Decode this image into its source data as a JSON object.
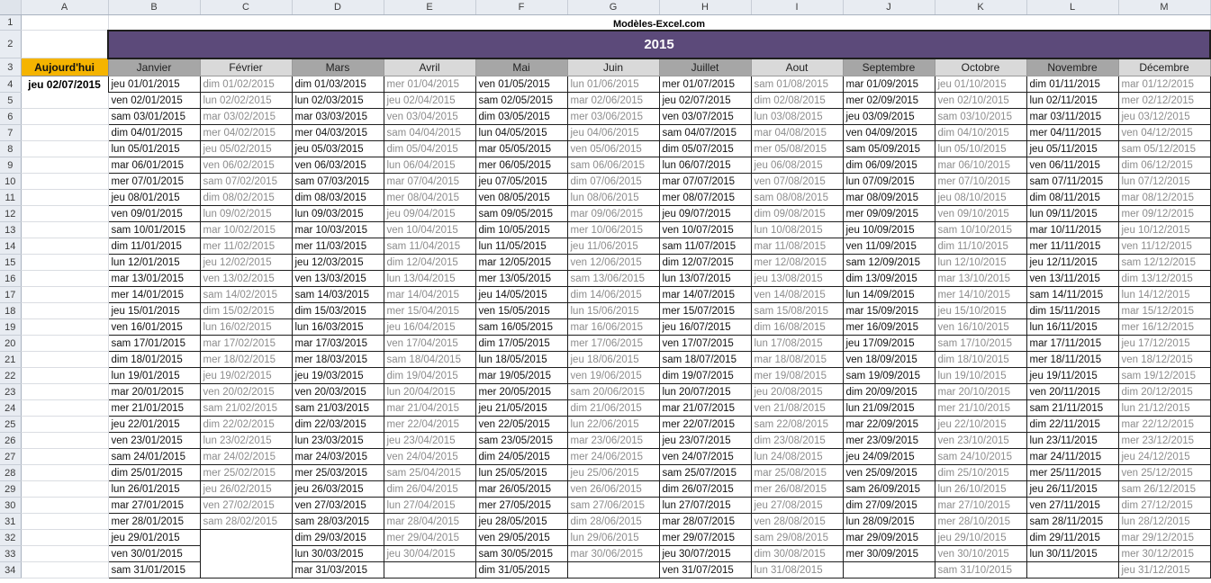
{
  "columns": [
    "A",
    "B",
    "C",
    "D",
    "E",
    "F",
    "G",
    "H",
    "I",
    "J",
    "K",
    "L",
    "M"
  ],
  "site_label": "Modèles-Excel.com",
  "year_label": "2015",
  "today": {
    "label": "Aujourd'hui",
    "value": "jeu 02/07/2015"
  },
  "months": [
    {
      "name": "Janvier",
      "first_wd": 4,
      "days": 31
    },
    {
      "name": "Février",
      "first_wd": 0,
      "days": 28
    },
    {
      "name": "Mars",
      "first_wd": 0,
      "days": 31
    },
    {
      "name": "Avril",
      "first_wd": 3,
      "days": 30
    },
    {
      "name": "Mai",
      "first_wd": 5,
      "days": 31
    },
    {
      "name": "Juin",
      "first_wd": 1,
      "days": 30
    },
    {
      "name": "Juillet",
      "first_wd": 3,
      "days": 31
    },
    {
      "name": "Aout",
      "first_wd": 6,
      "days": 31
    },
    {
      "name": "Septembre",
      "first_wd": 2,
      "days": 30
    },
    {
      "name": "Octobre",
      "first_wd": 4,
      "days": 31
    },
    {
      "name": "Novembre",
      "first_wd": 0,
      "days": 30
    },
    {
      "name": "Décembre",
      "first_wd": 2,
      "days": 31
    }
  ],
  "weekday_abbr": [
    "dim",
    "lun",
    "mar",
    "mer",
    "jeu",
    "ven",
    "sam"
  ],
  "year": 2015
}
